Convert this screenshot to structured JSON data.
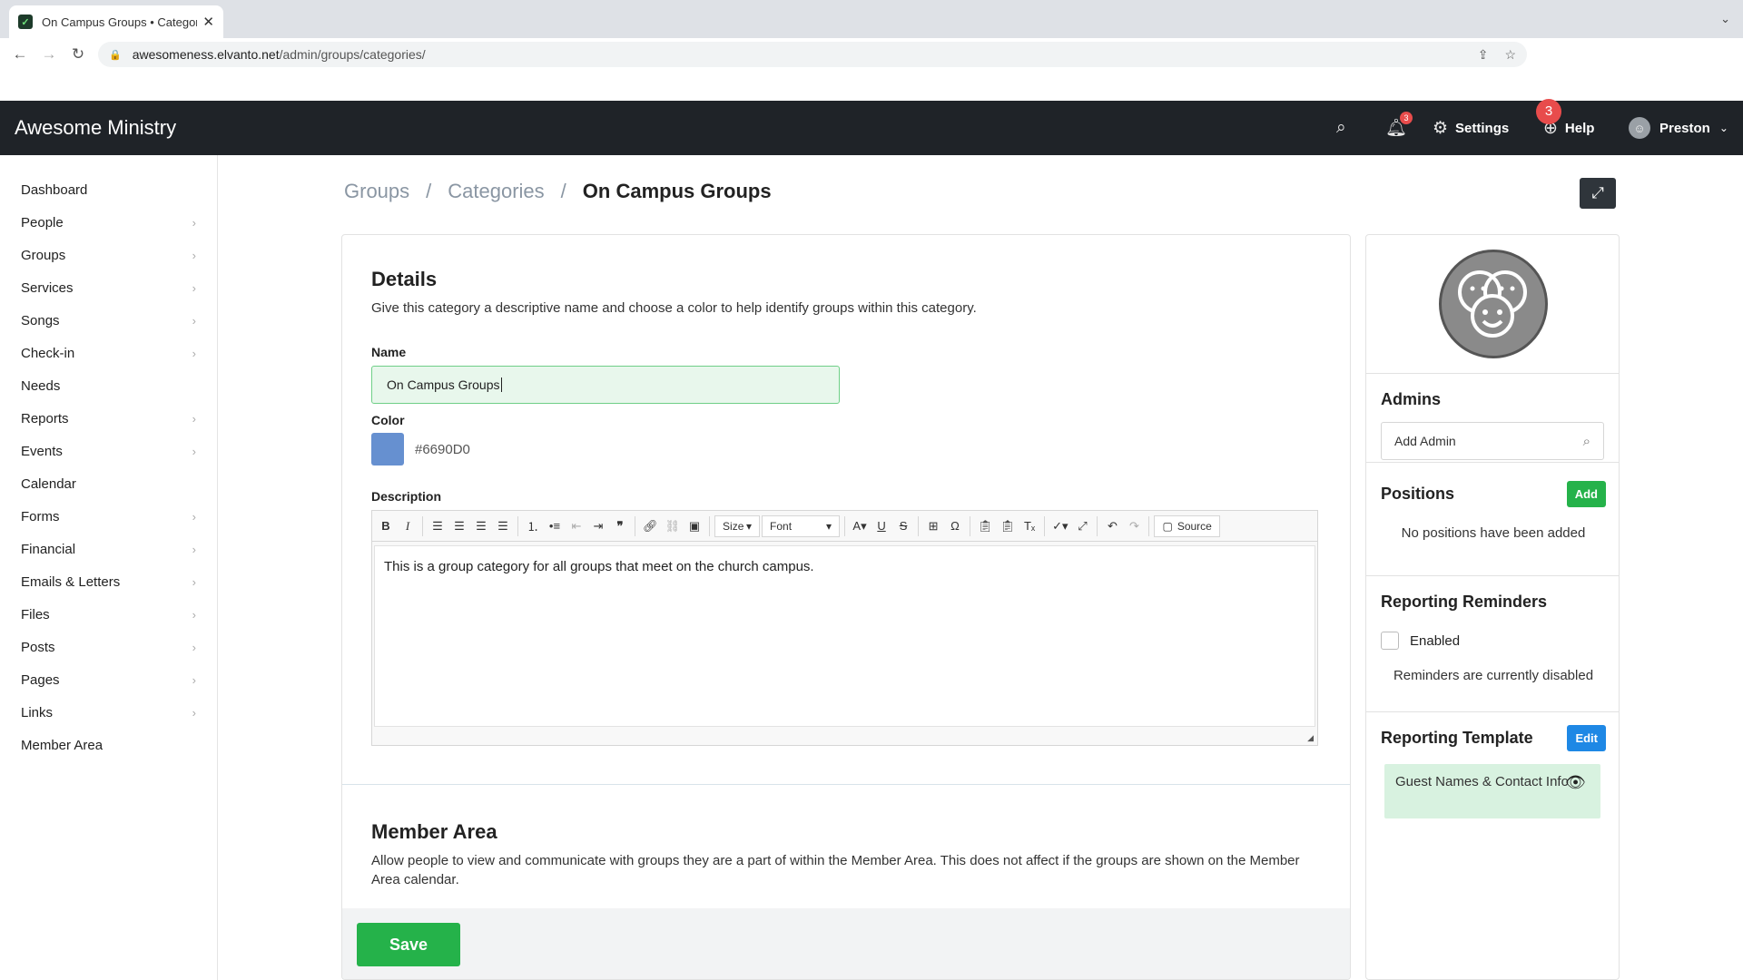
{
  "browser": {
    "tab_title": "On Campus Groups • Categori",
    "url_host": "awesomeness.elvanto.net",
    "url_path": "/admin/groups/categories/"
  },
  "header": {
    "brand": "Awesome Ministry",
    "notification_count": "3",
    "settings_label": "Settings",
    "help_badge": "3",
    "help_label": "Help",
    "user_name": "Preston"
  },
  "sidebar": {
    "items": [
      {
        "label": "Dashboard",
        "chevron": false
      },
      {
        "label": "People",
        "chevron": true
      },
      {
        "label": "Groups",
        "chevron": true
      },
      {
        "label": "Services",
        "chevron": true
      },
      {
        "label": "Songs",
        "chevron": true
      },
      {
        "label": "Check-in",
        "chevron": true
      },
      {
        "label": "Needs",
        "chevron": false
      },
      {
        "label": "Reports",
        "chevron": true
      },
      {
        "label": "Events",
        "chevron": true
      },
      {
        "label": "Calendar",
        "chevron": false
      },
      {
        "label": "Forms",
        "chevron": true
      },
      {
        "label": "Financial",
        "chevron": true
      },
      {
        "label": "Emails & Letters",
        "chevron": true
      },
      {
        "label": "Files",
        "chevron": true
      },
      {
        "label": "Posts",
        "chevron": true
      },
      {
        "label": "Pages",
        "chevron": true
      },
      {
        "label": "Links",
        "chevron": true
      },
      {
        "label": "Member Area",
        "chevron": false
      }
    ]
  },
  "breadcrumb": {
    "groups": "Groups",
    "sep": "/",
    "categories": "Categories",
    "current": "On Campus Groups"
  },
  "details": {
    "heading": "Details",
    "help": "Give this category a descriptive name and choose a color to help identify groups within this category.",
    "name_label": "Name",
    "name_value": "On Campus Groups",
    "color_label": "Color",
    "color_value": "#6690D0",
    "description_label": "Description",
    "description_text": "This is a group category for all groups that meet on the church campus.",
    "toolbar": {
      "size_label": "Size",
      "font_label": "Font",
      "source_label": "Source"
    }
  },
  "member_area": {
    "heading": "Member Area",
    "text": "Allow people to view and communicate with groups they are a part of within the Member Area. This does not affect if the groups are shown on the Member Area calendar."
  },
  "save_label": "Save",
  "panel": {
    "admins_heading": "Admins",
    "add_admin_placeholder": "Add Admin",
    "positions_heading": "Positions",
    "positions_add": "Add",
    "positions_empty": "No positions have been added",
    "reminders_heading": "Reporting Reminders",
    "reminders_enabled_label": "Enabled",
    "reminders_status": "Reminders are currently disabled",
    "template_heading": "Reporting Template",
    "template_edit": "Edit",
    "template_name": "Guest Names & Contact Info"
  }
}
